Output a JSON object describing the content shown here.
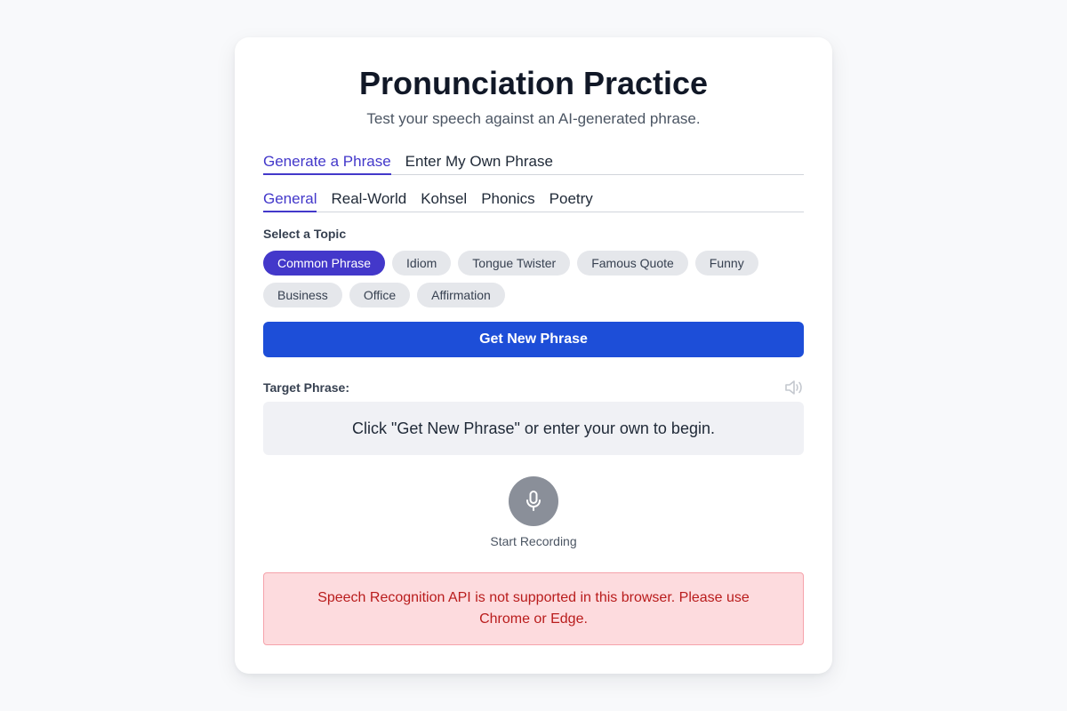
{
  "header": {
    "title": "Pronunciation Practice",
    "subtitle": "Test your speech against an AI-generated phrase."
  },
  "main_tabs": [
    {
      "label": "Generate a Phrase",
      "active": true
    },
    {
      "label": "Enter My Own Phrase",
      "active": false
    }
  ],
  "sub_tabs": [
    {
      "label": "General",
      "active": true
    },
    {
      "label": "Real-World",
      "active": false
    },
    {
      "label": "Kohsel",
      "active": false
    },
    {
      "label": "Phonics",
      "active": false
    },
    {
      "label": "Poetry",
      "active": false
    }
  ],
  "topics": {
    "label": "Select a Topic",
    "items": [
      {
        "label": "Common Phrase",
        "active": true
      },
      {
        "label": "Idiom",
        "active": false
      },
      {
        "label": "Tongue Twister",
        "active": false
      },
      {
        "label": "Famous Quote",
        "active": false
      },
      {
        "label": "Funny",
        "active": false
      },
      {
        "label": "Business",
        "active": false
      },
      {
        "label": "Office",
        "active": false
      },
      {
        "label": "Affirmation",
        "active": false
      }
    ]
  },
  "actions": {
    "get_phrase_label": "Get New Phrase"
  },
  "target": {
    "label": "Target Phrase:",
    "placeholder": "Click \"Get New Phrase\" or enter your own to begin.",
    "speaker_icon": "speaker-icon"
  },
  "recording": {
    "label": "Start Recording",
    "icon": "microphone-icon"
  },
  "error": {
    "message": "Speech Recognition API is not supported in this browser. Please use Chrome or Edge."
  },
  "colors": {
    "accent": "#4338ca",
    "primary_button": "#1d4ed8",
    "error_text": "#b91c1c",
    "error_bg": "#fddbde"
  }
}
